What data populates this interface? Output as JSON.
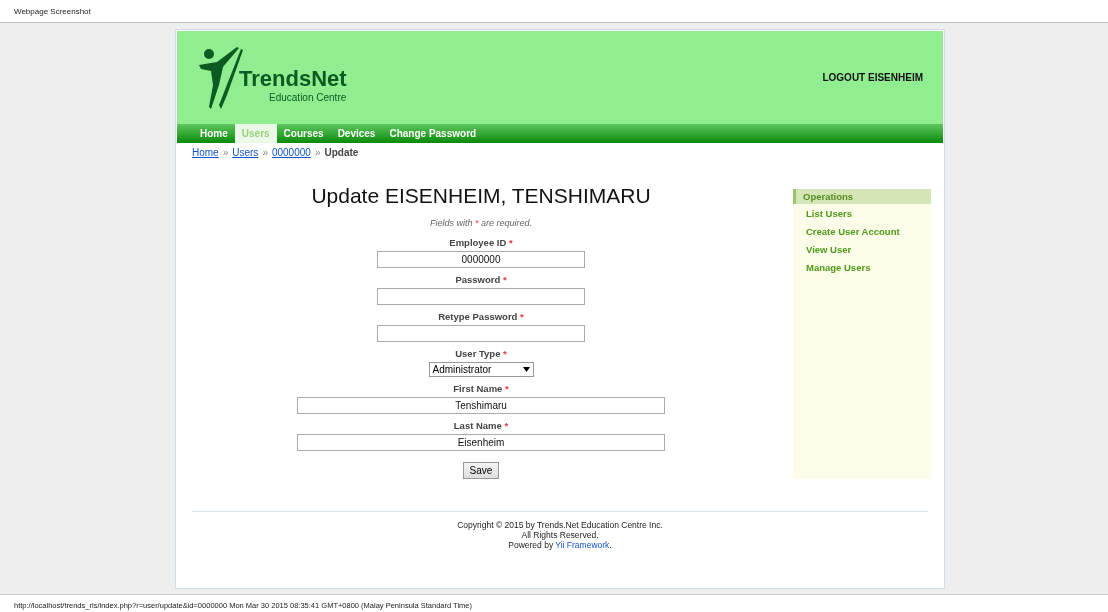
{
  "capture_title": "Webpage Screenshot",
  "header": {
    "brand": "TrendsNet",
    "tagline": "Education Centre",
    "logout": "LOGOUT EISENHEIM"
  },
  "nav": [
    {
      "label": "Home",
      "selected": false
    },
    {
      "label": "Users",
      "selected": true
    },
    {
      "label": "Courses",
      "selected": false
    },
    {
      "label": "Devices",
      "selected": false
    },
    {
      "label": "Change Password",
      "selected": false
    }
  ],
  "breadcrumb": {
    "links": [
      "Home",
      "Users",
      "0000000"
    ],
    "separator": "»",
    "current": "Update"
  },
  "title": "Update EISENHEIM, TENSHIMARU",
  "hint": {
    "before": "Fields with",
    "mark": "*",
    "after": "are required."
  },
  "fields": [
    {
      "kind": "short",
      "label": "Employee ID",
      "required_mark": "*",
      "value": "0000000"
    },
    {
      "kind": "short",
      "label": "Password",
      "required_mark": "*"
    },
    {
      "kind": "short",
      "label": "Retype Password",
      "required_mark": "*"
    },
    {
      "kind": "select",
      "label": "User Type",
      "required_mark": "*",
      "value": "Administrator"
    },
    {
      "kind": "long",
      "label": "First Name",
      "required_mark": "*",
      "value": "Tenshimaru"
    },
    {
      "kind": "long",
      "label": "Last Name",
      "required_mark": "*",
      "value": "Eisenheim"
    }
  ],
  "save_button": "Save",
  "operations": {
    "title": "Operations",
    "items": [
      "List Users",
      "Create User Account",
      "View User",
      "Manage Users"
    ]
  },
  "footer": {
    "copyright": "Copyright © 2015 by Trends.Net Education Centre Inc.",
    "rights": "All Rights Reserved.",
    "powered_before": "Powered by ",
    "powered_link": "Yii Framework",
    "powered_after": "."
  },
  "status_line": "http://localhost/trends_rls/index.php?r=user/update&id=0000000 Mon Mar 30 2015 08:35:41 GMT+0800 (Malay Peninsula Standard Time)"
}
